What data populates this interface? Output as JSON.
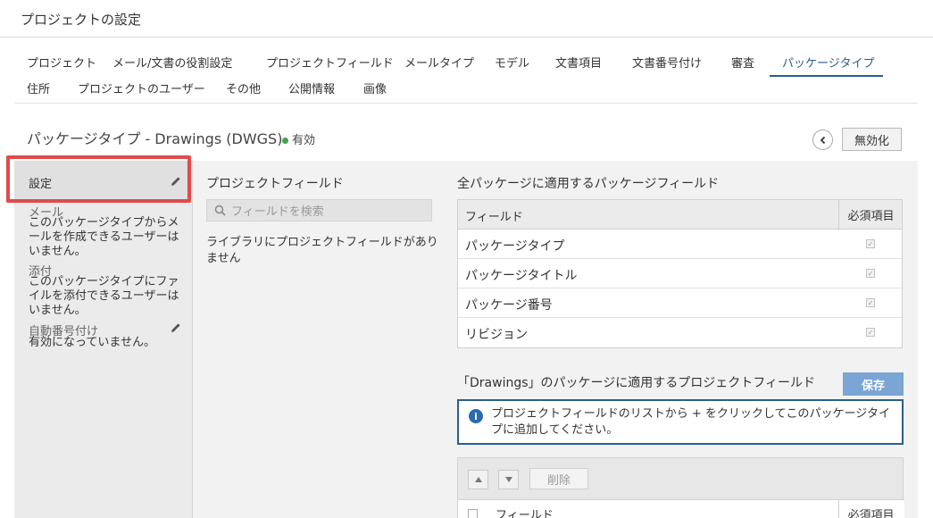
{
  "window": {
    "title": "プロジェクトの設定"
  },
  "tabs": {
    "row1": [
      "プロジェクト",
      "メール/文書の役割設定",
      "プロジェクトフィールド",
      "メールタイプ",
      "モデル",
      "文書項目",
      "文書番号付け",
      "審査",
      "パッケージタイプ"
    ],
    "row2": [
      "住所",
      "プロジェクトのユーザー",
      "その他",
      "公開情報",
      "画像"
    ],
    "active": "パッケージタイプ"
  },
  "header": {
    "title": "パッケージタイプ - Drawings (DWGS)",
    "status": "有効",
    "deactivate_label": "無効化"
  },
  "sidebar": {
    "settings_label": "設定",
    "mail_title": "メール",
    "mail_text": "このパッケージタイプからメールを作成できるユーザーはいません。",
    "attach_title": "添付",
    "attach_text": "このパッケージタイプにファイルを添付できるユーザーはいません。",
    "autonum_title": "自動番号付け",
    "autonum_text": "有効になっていません。"
  },
  "project_fields": {
    "title": "プロジェクトフィールド",
    "search_placeholder": "フィールドを検索",
    "empty_text": "ライブラリにプロジェクトフィールドがありません"
  },
  "package_fields": {
    "title": "全パッケージに適用するパッケージフィールド",
    "col_field": "フィールド",
    "col_required": "必須項目",
    "rows": [
      {
        "name": "パッケージタイプ",
        "required": true
      },
      {
        "name": "パッケージタイトル",
        "required": true
      },
      {
        "name": "パッケージ番号",
        "required": true
      },
      {
        "name": "リビジョン",
        "required": true
      }
    ]
  },
  "drawings_fields": {
    "title": "「Drawings」のパッケージに適用するプロジェクトフィールド",
    "save_label": "保存",
    "info_text": "プロジェクトフィールドのリストから + をクリックしてこのパッケージタイプに追加してください。",
    "delete_label": "削除",
    "col_field": "フィールド",
    "col_required": "必須項目"
  },
  "colors": {
    "accent": "#2a5e8c",
    "save": "#7aa5d4",
    "highlight": "#e04b4b",
    "status_dot": "#3fa34d"
  }
}
